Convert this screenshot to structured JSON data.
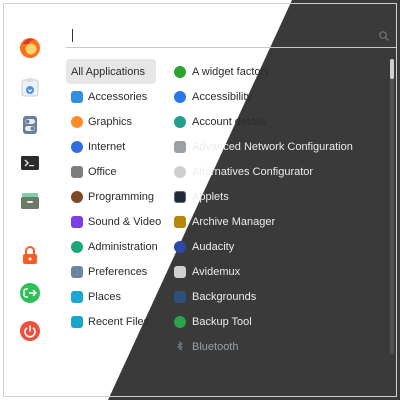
{
  "search": {
    "value": "",
    "placeholder": ""
  },
  "launcher": {
    "items": [
      {
        "icon": "firefox-icon",
        "color": "#ff6f1a"
      },
      {
        "icon": "install-icon",
        "color": "#5aa0e6"
      },
      {
        "icon": "settings-toggle-icon",
        "color": "#6a7f96"
      },
      {
        "icon": "terminal-icon",
        "color": "#2b2b2b"
      },
      {
        "icon": "file-manager-icon",
        "color": "#6b7a66"
      },
      {
        "icon": "lock-icon",
        "color": "#ff5a1f"
      },
      {
        "icon": "logout-icon",
        "color": "#2fbf57"
      },
      {
        "icon": "power-icon",
        "color": "#f04e3e"
      }
    ]
  },
  "categories": [
    {
      "label": "All Applications",
      "active": true,
      "icon": "",
      "color": ""
    },
    {
      "label": "Accessories",
      "icon": "accessories-icon",
      "color": "#2f8fe0"
    },
    {
      "label": "Graphics",
      "icon": "graphics-icon",
      "color": "#ff8a2a"
    },
    {
      "label": "Internet",
      "icon": "internet-icon",
      "color": "#2f6de0"
    },
    {
      "label": "Office",
      "icon": "office-icon",
      "color": "#7d7d7d"
    },
    {
      "label": "Programming",
      "icon": "programming-icon",
      "color": "#7a4a2a"
    },
    {
      "label": "Sound & Video",
      "icon": "sound-video-icon",
      "color": "#7b3fe4"
    },
    {
      "label": "Administration",
      "icon": "administration-icon",
      "color": "#1aa77c"
    },
    {
      "label": "Preferences",
      "icon": "preferences-icon",
      "color": "#6a86a3"
    },
    {
      "label": "Places",
      "icon": "places-icon",
      "color": "#1ca6d4"
    },
    {
      "label": "Recent Files",
      "icon": "recent-files-icon",
      "color": "#1aa5c8"
    }
  ],
  "apps": [
    {
      "label": "A widget factory",
      "icon": "widget-factory-icon",
      "color": "#2ca52c"
    },
    {
      "label": "Accessibility",
      "icon": "accessibility-icon",
      "color": "#2b78e4"
    },
    {
      "label": "Account details",
      "icon": "account-details-icon",
      "color": "#20a08d"
    },
    {
      "label": "Advanced Network Configuration",
      "icon": "network-icon",
      "color": "#9aa0a6"
    },
    {
      "label": "Alternatives Configurator",
      "icon": "alternatives-icon",
      "color": "#cfcfcf"
    },
    {
      "label": "Applets",
      "icon": "applets-icon",
      "color": "#1f2a36"
    },
    {
      "label": "Archive Manager",
      "icon": "archive-icon",
      "color": "#b8860b"
    },
    {
      "label": "Audacity",
      "icon": "audacity-icon",
      "color": "#2b4aa8"
    },
    {
      "label": "Avidemux",
      "icon": "avidemux-icon",
      "color": "#d0d0d0"
    },
    {
      "label": "Backgrounds",
      "icon": "backgrounds-icon",
      "color": "#2d4f7a"
    },
    {
      "label": "Backup Tool",
      "icon": "backup-icon",
      "color": "#2aa34a"
    },
    {
      "label": "Bluetooth",
      "icon": "bluetooth-icon",
      "color": "#6f7c8a"
    }
  ]
}
